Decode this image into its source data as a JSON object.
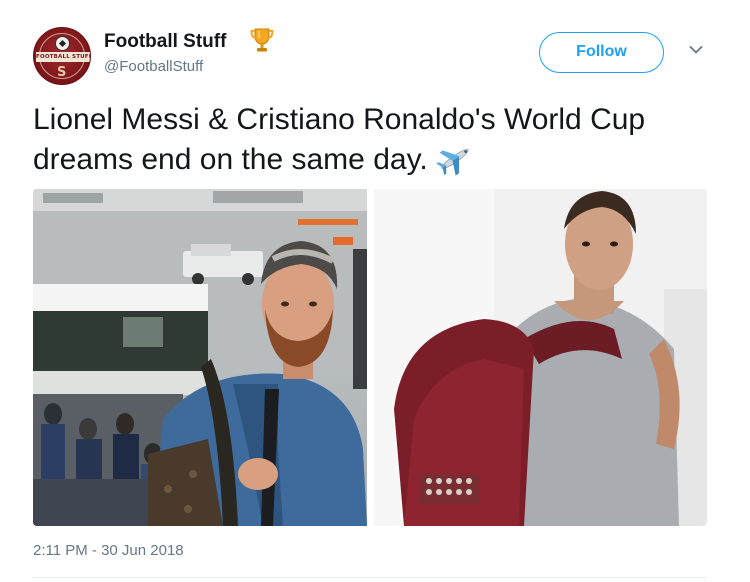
{
  "tweet": {
    "display_name": "Football Stuff",
    "handle": "@FootballStuff",
    "follow_label": "Follow",
    "text": "Lionel Messi & Cristiano Ronaldo's World Cup dreams end on the same day.",
    "timestamp": "2:11 PM - 30 Jun 2018",
    "avatar_text": "FOOTBALL STUFF",
    "avatar_glyph": "S"
  },
  "icons": {
    "name_emoji": "trophy-icon",
    "text_emoji": "airplane-icon",
    "more": "chevron-down-icon"
  },
  "colors": {
    "accent": "#1da1f2",
    "secondary_text": "#657786",
    "primary_text": "#14171a",
    "avatar_red": "#7a1418"
  }
}
